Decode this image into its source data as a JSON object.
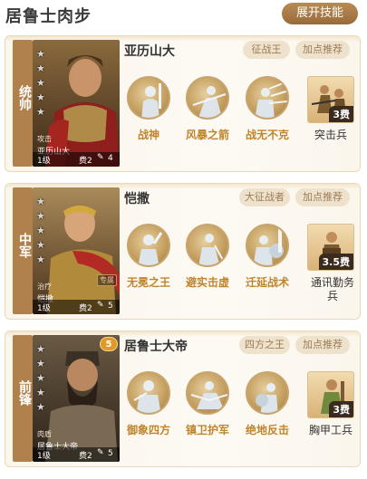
{
  "page": {
    "title": "居鲁士肉步",
    "expand_button": "展开技能"
  },
  "cards": [
    {
      "role": "统帅",
      "hero": {
        "type": "攻击",
        "name": "亚历山大",
        "level": "1级",
        "cost": "费2",
        "extra": "4",
        "special": ""
      },
      "tags": [
        "征战王",
        "加点推荐"
      ],
      "skills": [
        "战神",
        "风暴之箭",
        "战无不克"
      ],
      "unit": {
        "cost": "3费",
        "name": "突击兵"
      }
    },
    {
      "role": "中军",
      "hero": {
        "type": "治疗",
        "name": "恺撒",
        "level": "1级",
        "cost": "费2",
        "extra": "5",
        "special": "专属"
      },
      "tags": [
        "大征战者",
        "加点推荐"
      ],
      "skills": [
        "无冕之王",
        "避实击虚",
        "迁延战术"
      ],
      "unit": {
        "cost": "3.5费",
        "name": "通讯勤务兵"
      }
    },
    {
      "role": "前锋",
      "hero": {
        "type": "肉盾",
        "name": "居鲁士大帝",
        "level": "1级",
        "cost": "费2",
        "extra": "5",
        "badge": "5"
      },
      "tags": [
        "四方之王",
        "加点推荐"
      ],
      "skills": [
        "御象四方",
        "镇卫护军",
        "绝地反击"
      ],
      "unit": {
        "cost": "3费",
        "name": "胸甲工兵"
      }
    }
  ]
}
